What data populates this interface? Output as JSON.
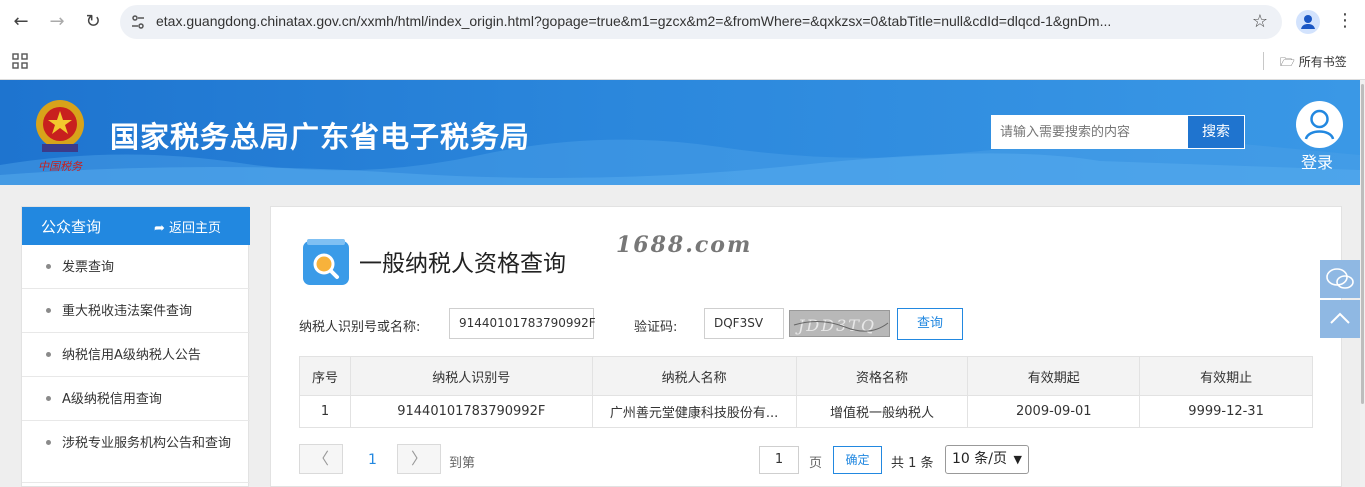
{
  "browser": {
    "url": "etax.guangdong.chinatax.gov.cn/xxmh/html/index_origin.html?gopage=true&m1=gzcx&m2=&fromWhere=&qxkzsx=0&tabTitle=null&cdId=dlqcd-1&gnDm...",
    "bookmarks_folder": "所有书签"
  },
  "header": {
    "site_title": "国家税务总局广东省电子税务局",
    "emblem_caption": "中国税务",
    "search_placeholder": "请输入需要搜索的内容",
    "search_label": "搜索",
    "login_label": "登录"
  },
  "sidebar": {
    "title": "公众查询",
    "back_label": "返回主页",
    "items": [
      {
        "label": "发票查询"
      },
      {
        "label": "重大税收违法案件查询"
      },
      {
        "label": "纳税信用A级纳税人公告"
      },
      {
        "label": "A级纳税信用查询"
      },
      {
        "label": "涉税专业服务机构公告和查询"
      }
    ]
  },
  "main": {
    "page_title": "一般纳税人资格查询",
    "watermark": "1688.com",
    "form": {
      "taxpayer_label": "纳税人识别号或名称:",
      "taxpayer_value": "91440101783790992F",
      "captcha_label": "验证码:",
      "captcha_value": "DQF3SV",
      "captcha_image_text": "JDD3TQ",
      "query_label": "查询"
    },
    "table": {
      "headers": [
        "序号",
        "纳税人识别号",
        "纳税人名称",
        "资格名称",
        "有效期起",
        "有效期止"
      ],
      "rows": [
        [
          "1",
          "91440101783790992F",
          "广州善元堂健康科技股份有...",
          "增值税一般纳税人",
          "2009-09-01",
          "9999-12-31"
        ]
      ]
    },
    "pagination": {
      "prev": "〈",
      "current_page": "1",
      "next": "〉",
      "goto_label": "到第",
      "goto_value": "1",
      "page_unit": "页",
      "confirm_label": "确定",
      "total_text": "共 1 条",
      "page_size": "10 条/页"
    }
  }
}
